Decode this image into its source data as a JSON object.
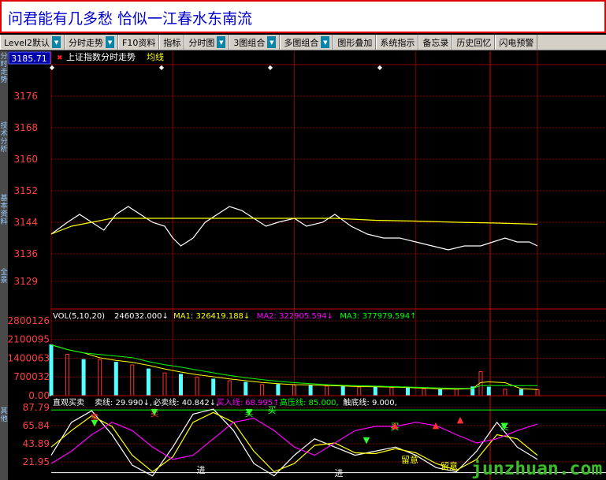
{
  "banner": {
    "text": "问君能有几多愁 恰似一江春水东南流"
  },
  "toolbar": {
    "items": [
      {
        "label": "Level2默认",
        "arrow": true
      },
      {
        "label": "分时走势",
        "arrow": true
      },
      {
        "label": "F10资料",
        "arrow": false
      },
      {
        "label": "指标",
        "arrow": false
      },
      {
        "label": "分时图",
        "arrow": true
      },
      {
        "label": "3图组合",
        "arrow": true
      },
      {
        "label": "多图组合",
        "arrow": true
      },
      {
        "label": "图形叠加",
        "arrow": false
      },
      {
        "label": "系统指示",
        "arrow": false
      },
      {
        "label": "备忘录",
        "arrow": false
      },
      {
        "label": "历史回忆",
        "arrow": false
      },
      {
        "label": "闪电预警",
        "arrow": false
      }
    ]
  },
  "sidebar": {
    "tabs": [
      "分时走势",
      "技术分析",
      "基本资料",
      "全景",
      "其他"
    ]
  },
  "watermark": "junzhuan.com",
  "colors": {
    "up": "#ff3333",
    "down": "#55ffff",
    "grid": "#8b0000",
    "price_line": "#ffffff",
    "avg_line": "#ffff00",
    "ma1": "#ffff00",
    "ma2": "#ff00ff",
    "ma3": "#00ff00"
  },
  "chart_data": [
    {
      "type": "line",
      "title": "上证指数分时走势",
      "current_value_label": "3185.71",
      "legend": [
        "均线"
      ],
      "y_ticks": [
        "3176",
        "3168",
        "3160",
        "3152",
        "3144",
        "3136",
        "3129"
      ],
      "ylim": [
        3122,
        3184
      ],
      "series": [
        {
          "name": "",
          "color": "#ffffff",
          "x": [
            0,
            8,
            14,
            20,
            26,
            32,
            38,
            44,
            50,
            56,
            60,
            64,
            70,
            76,
            82,
            88,
            94,
            100,
            106,
            112,
            120,
            126,
            134,
            140,
            148,
            156,
            164,
            172,
            180,
            188,
            196,
            204,
            212,
            218,
            224,
            230,
            236,
            240
          ],
          "y": [
            3141,
            3144,
            3146,
            3144,
            3142,
            3146,
            3148,
            3146,
            3144,
            3143,
            3140,
            3138,
            3140,
            3144,
            3146,
            3148,
            3147,
            3145,
            3143,
            3144,
            3145,
            3143,
            3144,
            3146,
            3143,
            3141,
            3140,
            3140,
            3139,
            3138,
            3137,
            3138,
            3138,
            3139,
            3140,
            3139,
            3139,
            3138
          ]
        },
        {
          "name": "均线",
          "color": "#ffff00",
          "x": [
            0,
            10,
            20,
            30,
            40,
            60,
            80,
            100,
            120,
            140,
            160,
            180,
            200,
            220,
            240
          ],
          "y": [
            3141,
            3143,
            3144,
            3145,
            3145,
            3145,
            3145,
            3145,
            3145,
            3145,
            3144.5,
            3144.3,
            3144,
            3143.8,
            3143.5
          ]
        }
      ]
    },
    {
      "type": "bar",
      "title": "VOL(5,10,20)",
      "legend": [
        {
          "label": "246032.000",
          "arrow": "↓",
          "color": "#ffffff"
        },
        {
          "label": "MA1: 326419.188",
          "arrow": "↓",
          "color": "#ffff00"
        },
        {
          "label": "MA2: 322905.594",
          "arrow": "↓",
          "color": "#ff00ff"
        },
        {
          "label": "MA3: 377979.594",
          "arrow": "↑",
          "color": "#00ff00"
        }
      ],
      "y_ticks": [
        "2800126",
        "2100095",
        "1400063",
        "700032",
        "0.00"
      ],
      "ylim": [
        0,
        2800126
      ],
      "x": [
        0,
        8,
        16,
        24,
        32,
        40,
        48,
        56,
        64,
        72,
        80,
        88,
        96,
        104,
        112,
        120,
        128,
        136,
        144,
        152,
        160,
        168,
        176,
        184,
        192,
        200,
        208,
        212,
        216,
        224,
        232,
        240
      ],
      "values": [
        1900000,
        1550000,
        1350000,
        1350000,
        1250000,
        1150000,
        1000000,
        850000,
        800000,
        700000,
        620000,
        560000,
        500000,
        420000,
        420000,
        400000,
        380000,
        360000,
        340000,
        320000,
        340000,
        300000,
        280000,
        260000,
        220000,
        250000,
        330000,
        900000,
        320000,
        240000,
        230000,
        220000
      ],
      "up": [
        false,
        true,
        false,
        true,
        false,
        true,
        false,
        true,
        false,
        true,
        false,
        true,
        false,
        true,
        false,
        true,
        false,
        true,
        false,
        true,
        false,
        true,
        false,
        true,
        false,
        true,
        false,
        true,
        false,
        true,
        false,
        true
      ]
    },
    {
      "type": "line",
      "title": "直观买卖",
      "legend": [
        {
          "label": "卖线: 29.990",
          "arrow": "↓",
          "color": "#ffffff"
        },
        {
          "label": "必卖线: 40.842",
          "arrow": "↓",
          "color": "#ffffff"
        },
        {
          "label": "买入线: 68.995",
          "arrow": "↑",
          "color": "#ff00ff"
        },
        {
          "label": "高压线: 85.000",
          "arrow": "",
          "color": "#00ff00"
        },
        {
          "label": "触底线: 9.000",
          "arrow": "",
          "color": "#ffffff"
        }
      ],
      "y_ticks": [
        "87.79",
        "65.84",
        "43.89",
        "21.95"
      ],
      "ylim": [
        0,
        88
      ],
      "signals": [
        {
          "text": "卖",
          "kind": "sell"
        },
        {
          "text": "卖",
          "kind": "sell"
        },
        {
          "text": "买",
          "kind": "buy"
        },
        {
          "text": "买",
          "kind": "buy"
        },
        {
          "text": "进",
          "kind": "entry"
        },
        {
          "text": "进",
          "kind": "entry"
        },
        {
          "text": "留意",
          "kind": "note"
        },
        {
          "text": "留意",
          "kind": "note"
        },
        {
          "text": "买",
          "kind": "buy"
        },
        {
          "text": "买",
          "kind": "buy"
        }
      ],
      "series": [
        {
          "name": "",
          "color": "#ffffff",
          "x": [
            0,
            10,
            20,
            30,
            40,
            50,
            60,
            70,
            80,
            90,
            100,
            110,
            120,
            130,
            140,
            150,
            160,
            170,
            180,
            190,
            200,
            210,
            220,
            230,
            240
          ],
          "y": [
            30,
            70,
            84,
            55,
            18,
            5,
            40,
            80,
            86,
            60,
            20,
            5,
            30,
            50,
            40,
            30,
            35,
            40,
            30,
            15,
            10,
            35,
            70,
            40,
            25
          ]
        },
        {
          "name": "",
          "color": "#ffff00",
          "x": [
            0,
            10,
            20,
            30,
            40,
            50,
            60,
            70,
            80,
            90,
            100,
            110,
            120,
            130,
            140,
            150,
            160,
            170,
            180,
            190,
            200,
            210,
            220,
            230,
            240
          ],
          "y": [
            40,
            60,
            78,
            65,
            30,
            10,
            28,
            70,
            82,
            70,
            35,
            10,
            20,
            42,
            45,
            33,
            32,
            38,
            33,
            20,
            12,
            25,
            55,
            50,
            30
          ]
        },
        {
          "name": "",
          "color": "#ff00ff",
          "x": [
            0,
            10,
            20,
            30,
            40,
            50,
            60,
            70,
            80,
            90,
            100,
            110,
            120,
            130,
            140,
            150,
            160,
            170,
            180,
            190,
            200,
            210,
            220,
            230,
            240
          ],
          "y": [
            20,
            35,
            55,
            70,
            60,
            40,
            25,
            30,
            50,
            70,
            75,
            60,
            40,
            30,
            45,
            60,
            65,
            65,
            70,
            66,
            55,
            45,
            50,
            60,
            68
          ]
        }
      ],
      "hlines": [
        {
          "value": 85,
          "color": "#00ff00"
        },
        {
          "value": 9,
          "color": "#ffffff"
        }
      ]
    }
  ]
}
